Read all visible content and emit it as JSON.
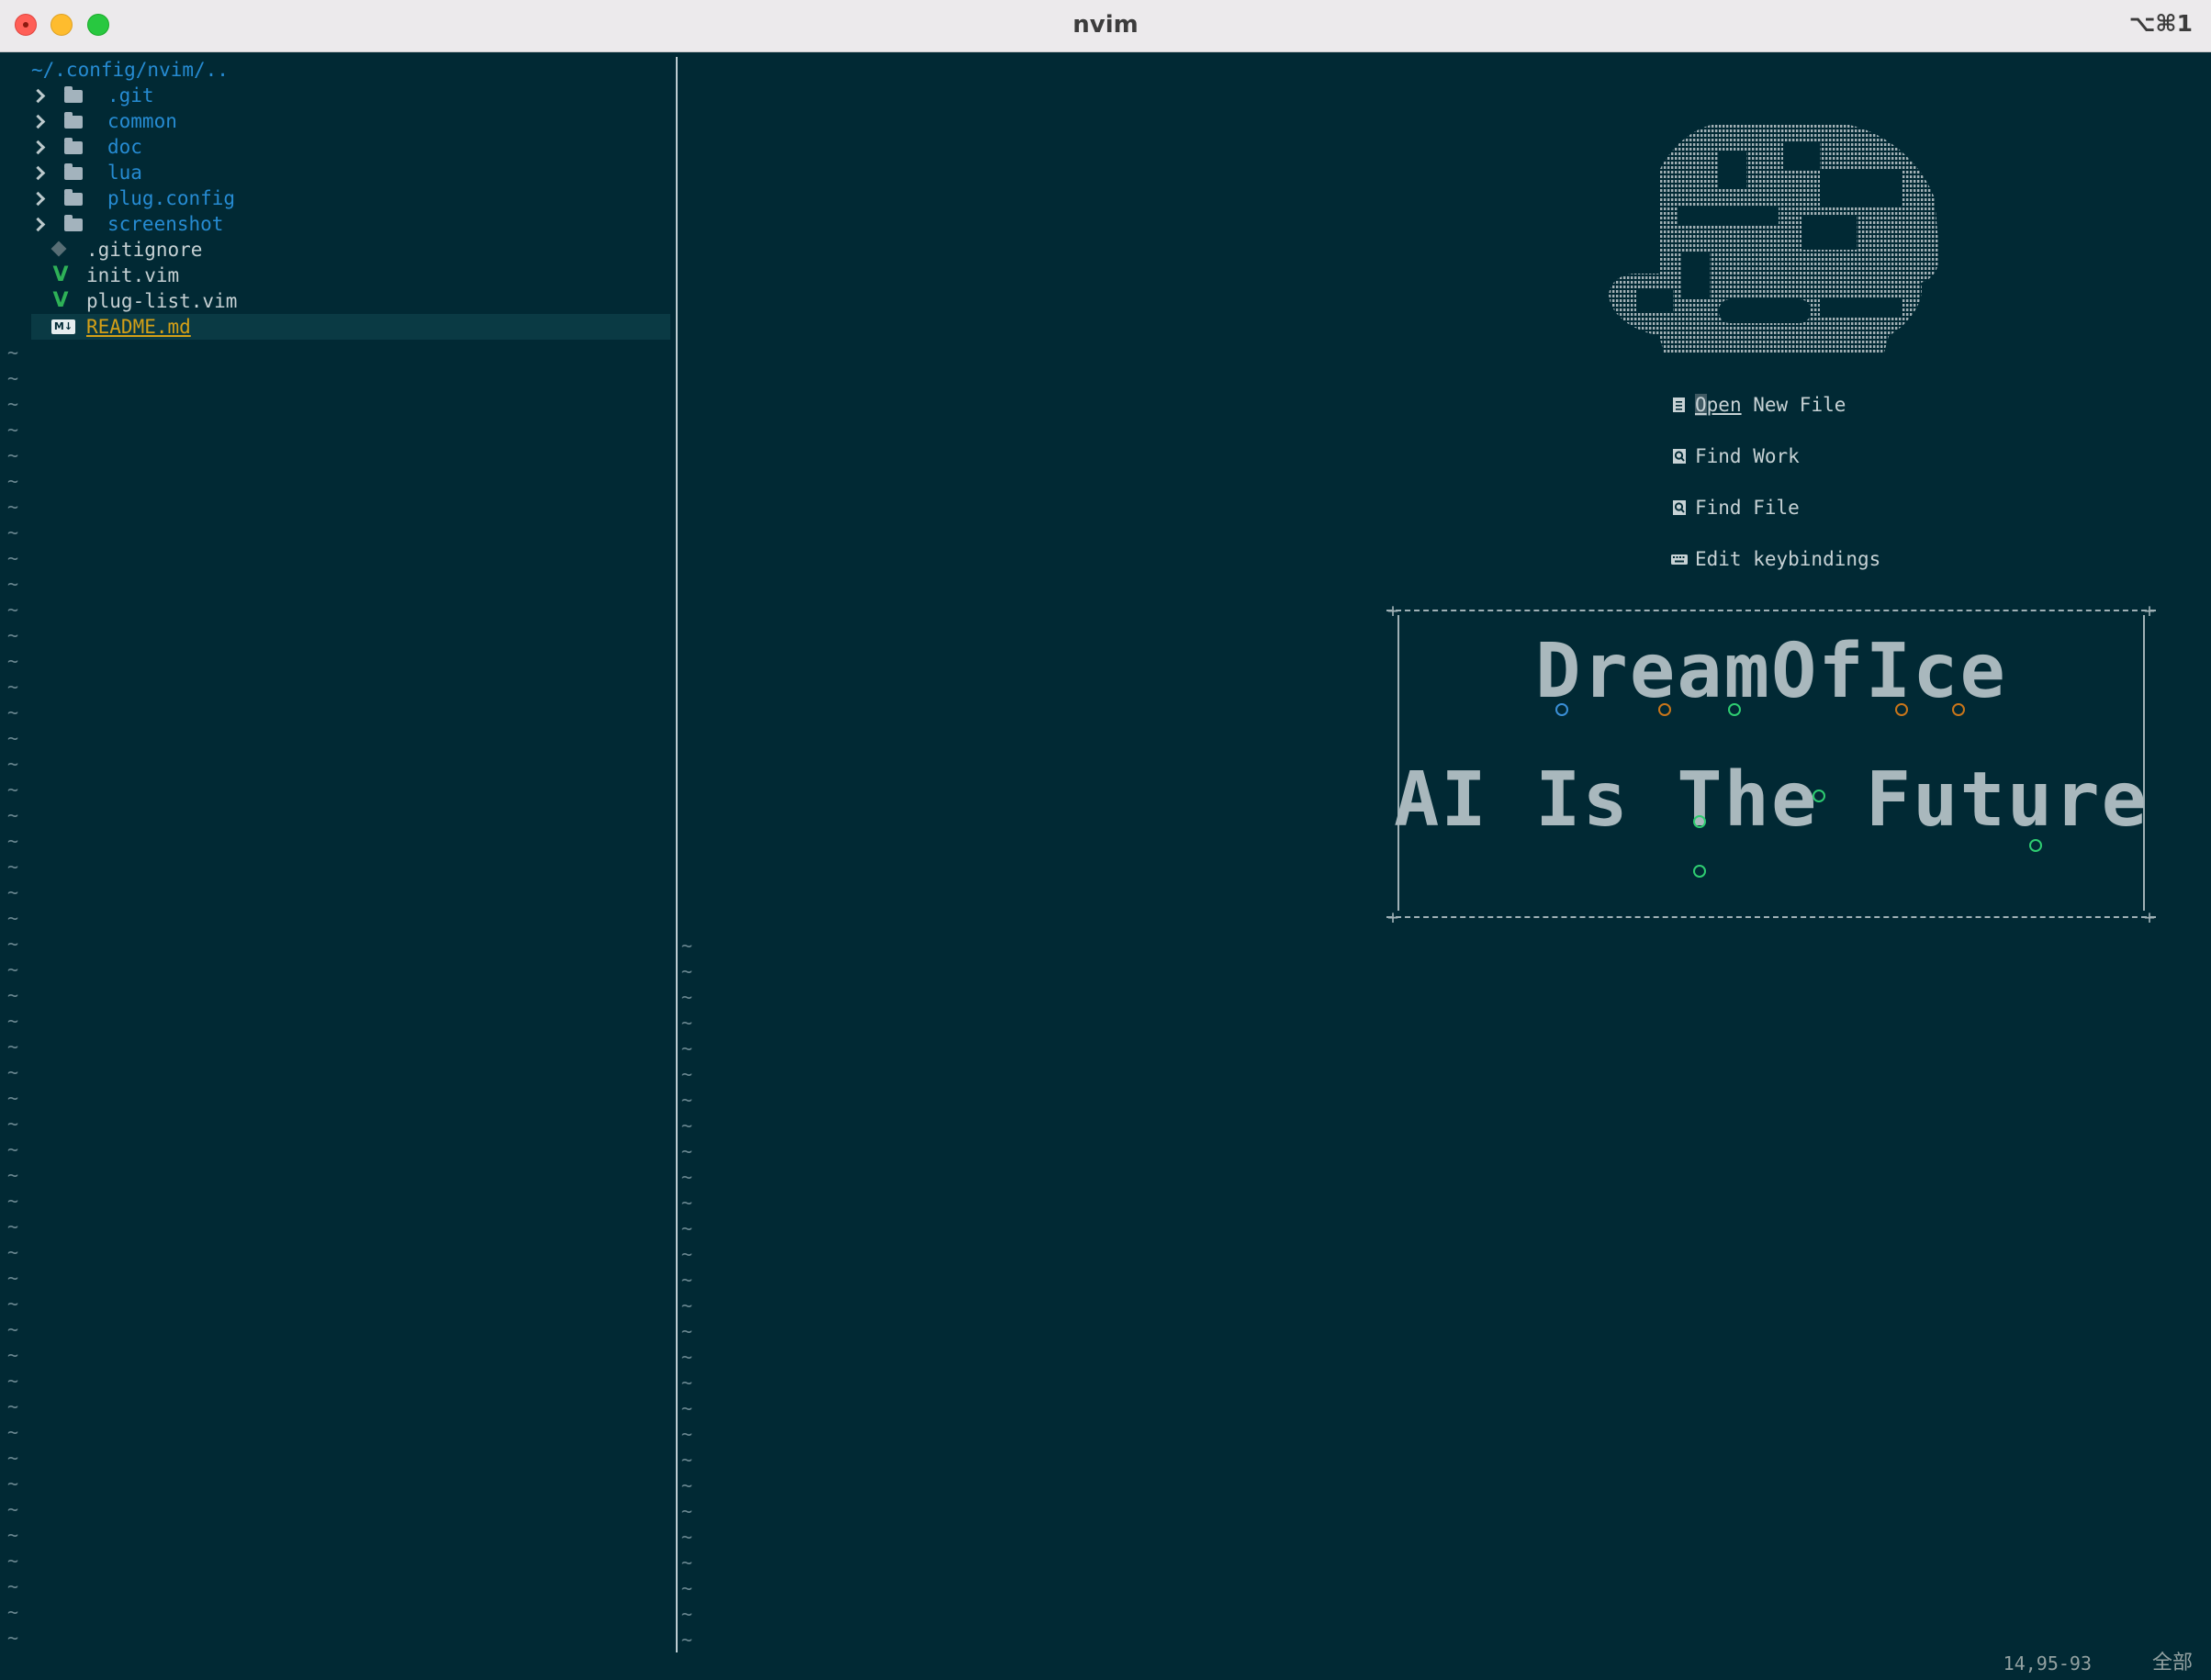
{
  "window": {
    "title": "nvim",
    "shortcut": "⌥⌘1"
  },
  "tree": {
    "root": "~/.config/nvim/..",
    "folders": [
      ".git",
      "common",
      "doc",
      "lua",
      "plug.config",
      "screenshot"
    ],
    "files": [
      {
        "name": ".gitignore",
        "icon": "git-icon"
      },
      {
        "name": "init.vim",
        "icon": "vim-icon"
      },
      {
        "name": "plug-list.vim",
        "icon": "vim-icon"
      },
      {
        "name": "README.md",
        "icon": "markdown-icon",
        "selected": true
      }
    ]
  },
  "tilde": "~",
  "dashboard": {
    "menu": [
      {
        "key_letter": "O",
        "key_rest": "pen",
        "rest": " New File",
        "icon": "new-file-icon"
      },
      {
        "label": "Find Work",
        "icon": "find-icon"
      },
      {
        "label": "Find File",
        "icon": "find-icon"
      },
      {
        "label": "Edit keybindings",
        "icon": "keyboard-icon"
      }
    ],
    "banner_line1": "DreamOfIce",
    "banner_line2": "AI Is The Future"
  },
  "status": {
    "position": "14,95-93",
    "scroll": "全部"
  }
}
